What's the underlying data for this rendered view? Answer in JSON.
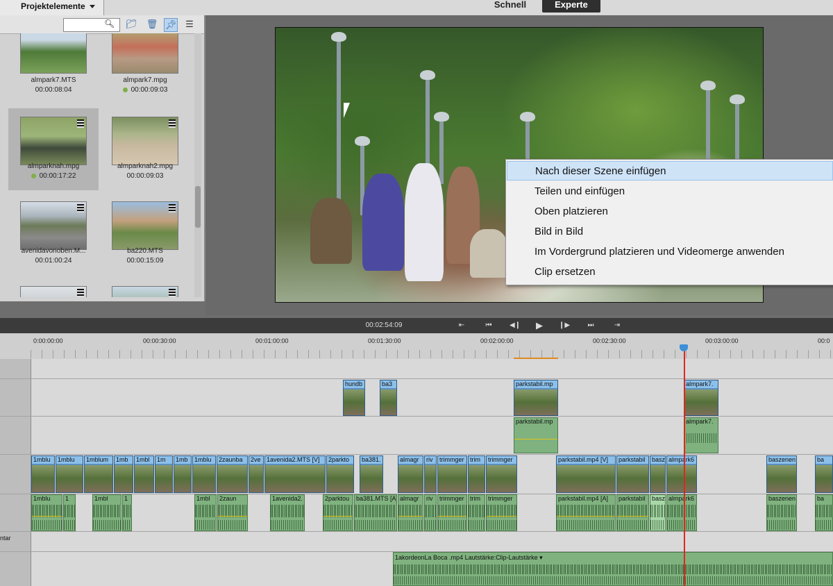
{
  "header": {
    "panel_tab": "Projektelemente",
    "mode_quick": "Schnell",
    "mode_expert": "Experte"
  },
  "project_panel": {
    "search_placeholder": "",
    "items": [
      {
        "name": "almpark7.MTS",
        "duration": "00:00:08:04",
        "used": false
      },
      {
        "name": "almpark7.mpg",
        "duration": "00:00:09:03",
        "used": true
      },
      {
        "name": "almparknah.mpg",
        "duration": "00:00:17:22",
        "used": true,
        "selected": true
      },
      {
        "name": "almparknah2.mpg",
        "duration": "00:00:09:03",
        "used": false
      },
      {
        "name": "avenidavonoben.M...",
        "duration": "00:01:00:24",
        "used": false
      },
      {
        "name": "ba220.MTS",
        "duration": "00:00:15:09",
        "used": false
      }
    ]
  },
  "context_menu": {
    "items": [
      "Nach dieser Szene einfügen",
      "Teilen und einfügen",
      "Oben platzieren",
      "Bild in Bild",
      "Im Vordergrund platzieren und Videomerge anwenden",
      "Clip ersetzen"
    ],
    "highlighted_index": 0
  },
  "transport": {
    "timecode": "00:02:54:09",
    "buttons": [
      "rewind-to-start",
      "previous-edit",
      "step-back",
      "play",
      "step-forward",
      "next-edit",
      "go-to-end"
    ]
  },
  "timeline": {
    "ruler_ticks": [
      "0:00:00:00",
      "00:00:30:00",
      "00:01:00:00",
      "00:01:30:00",
      "00:02:00:00",
      "00:02:30:00",
      "00:03:00:00",
      "00:0"
    ],
    "track_label": "ntar",
    "overlay_video_clips": [
      "hundb",
      "ba3",
      "parkstabil.mp",
      "almpark7."
    ],
    "overlay_audio_clips": [
      "parkstabil.mp",
      "almpark7."
    ],
    "main_video_clips": [
      "1mblu",
      "1mblu",
      "1mblum",
      "1mb",
      "1mbl",
      "1m",
      "1mb",
      "1mblu",
      "2zaunba",
      "2ve",
      "1avenida2.MTS [V]",
      "2parkto",
      "ba381.",
      "almagr",
      "riv",
      "trimmger",
      "trim",
      "trimmger",
      "parkstabil.mp4 [V]",
      "parkstabil",
      "basz",
      "almpark6",
      "baszenen",
      "ba"
    ],
    "main_audio_clips": [
      "1mblu",
      "1",
      "1mbl",
      "1",
      "1mbl",
      "2zaun",
      "1avenida2.",
      "2parktou",
      "ba381.MTS [A]",
      "almagr",
      "riv",
      "trimmger",
      "trim",
      "trimmger",
      "parkstabil.mp4 [A]",
      "parkstabil",
      "basz",
      "almpark6",
      "baszenen",
      "ba"
    ],
    "music_clip": "1akordeonLa Boca .mp4  Lautstärke:Clip-Lautstärke ▾"
  }
}
